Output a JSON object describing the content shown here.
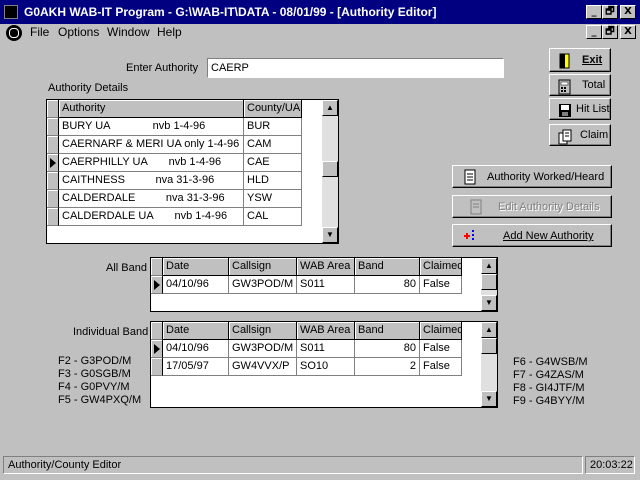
{
  "window": {
    "title": "G0AKH WAB-IT Program - G:\\WAB-IT\\DATA - 08/01/99 - [Authority Editor]",
    "caption_buttons": [
      "_",
      "🗗",
      "X"
    ],
    "doc_buttons": [
      "_",
      "🗗",
      "X"
    ]
  },
  "menu": [
    "File",
    "Options",
    "Window",
    "Help"
  ],
  "enter_authority": {
    "label": "Enter Authority",
    "value": "CAERP"
  },
  "authority_details": {
    "label": "Authority Details",
    "columns": [
      "Authority",
      "County/UA"
    ],
    "rows": [
      {
        "authority": "BURY UA              nvb 1-4-96",
        "county": "BUR",
        "current": false
      },
      {
        "authority": "CAERNARF & MERI UA only 1-4-96",
        "county": "CAM",
        "current": false
      },
      {
        "authority": "CAERPHILLY UA       nvb 1-4-96",
        "county": "CAE",
        "current": true
      },
      {
        "authority": "CAITHNESS          nva 31-3-96",
        "county": "HLD",
        "current": false
      },
      {
        "authority": "CALDERDALE          nva 31-3-96",
        "county": "YSW",
        "current": false
      },
      {
        "authority": "CALDERDALE UA       nvb 1-4-96",
        "county": "CAL",
        "current": false
      }
    ]
  },
  "buttons": {
    "exit": "Exit",
    "total": "Total",
    "hit_list": "Hit List",
    "claim": "Claim",
    "authority_worked": "Authority Worked/Heard",
    "edit_authority": "Edit Authority Details",
    "add_authority": "Add New Authority"
  },
  "all_band": {
    "label": "All Band",
    "columns": [
      "Date",
      "Callsign",
      "WAB Area",
      "Band",
      "Claimed"
    ],
    "rows": [
      {
        "date": "04/10/96",
        "callsign": "GW3POD/M",
        "area": "S011",
        "band": "80",
        "claimed": "False",
        "current": true
      }
    ]
  },
  "individual_band": {
    "label": "Individual Band",
    "columns": [
      "Date",
      "Callsign",
      "WAB Area",
      "Band",
      "Claimed"
    ],
    "rows": [
      {
        "date": "04/10/96",
        "callsign": "GW3POD/M",
        "area": "S011",
        "band": "80",
        "claimed": "False",
        "current": true
      },
      {
        "date": "17/05/97",
        "callsign": "GW4VVX/P",
        "area": "SO10",
        "band": "2",
        "claimed": "False",
        "current": false
      }
    ]
  },
  "fkeys_left": [
    "F2 -  G3POD/M",
    "F3 -  G0SGB/M",
    "F4 -  G0PVY/M",
    "F5 -  GW4PXQ/M"
  ],
  "fkeys_right": [
    "F6 -  G4WSB/M",
    "F7 -  G4ZAS/M",
    "F8 -  GI4JTF/M",
    "F9 -  G4BYY/M"
  ],
  "status": {
    "left": "Authority/County Editor",
    "time": "20:03:22"
  }
}
